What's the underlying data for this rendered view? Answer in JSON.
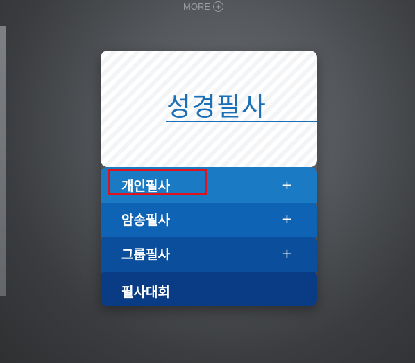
{
  "header": {
    "more_label": "MORE",
    "more_icon": "plus-circle-icon"
  },
  "card": {
    "title": "성경필사",
    "accent_color": "#1b6fb6"
  },
  "menu": {
    "items": [
      {
        "label": "개인필사",
        "expand_icon": "+",
        "color": "#1a7ac4"
      },
      {
        "label": "암송필사",
        "expand_icon": "+",
        "color": "#0f63b4"
      },
      {
        "label": "그룹필사",
        "expand_icon": "+",
        "color": "#0b4f9c"
      },
      {
        "label": "필사대회",
        "color": "#0a3c85"
      }
    ]
  },
  "highlight": {
    "color": "#e0121b",
    "target": "개인필사"
  }
}
